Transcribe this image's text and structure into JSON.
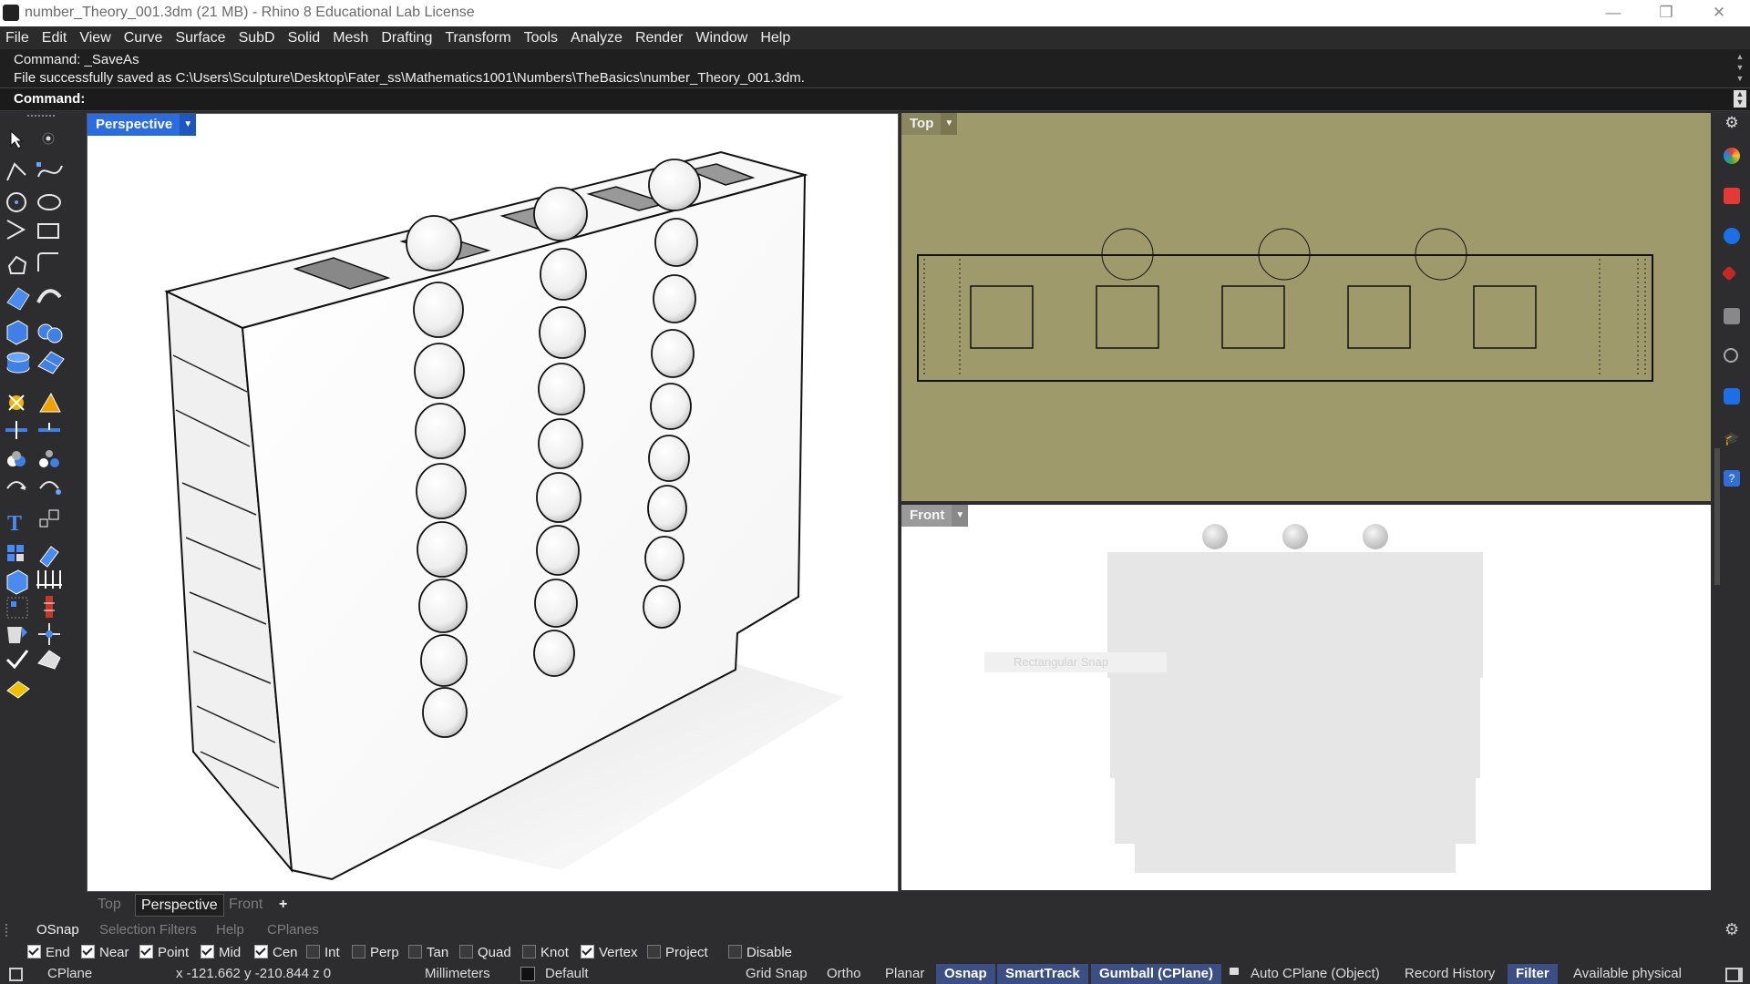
{
  "window": {
    "title": "number_Theory_001.3dm (21 MB) - Rhino 8 Educational Lab License",
    "controls": [
      "minimize-icon",
      "restore-icon",
      "close-icon"
    ]
  },
  "menu": [
    "File",
    "Edit",
    "View",
    "Curve",
    "Surface",
    "SubD",
    "Solid",
    "Mesh",
    "Drafting",
    "Transform",
    "Tools",
    "Analyze",
    "Render",
    "Window",
    "Help"
  ],
  "command": {
    "history_line1": "Command: _SaveAs",
    "history_line2": "File successfully saved as C:\\Users\\Sculpture\\Desktop\\Fater_ss\\Mathematics1001\\Numbers\\TheBasics\\number_Theory_001.3dm.",
    "prompt": "Command:"
  },
  "viewports": {
    "perspective": {
      "label": "Perspective"
    },
    "top": {
      "label": "Top"
    },
    "front": {
      "label": "Front",
      "ghost_hint": "Rectangular Snap"
    }
  },
  "viewport_tabs": [
    "Top",
    "Perspective",
    "Front",
    "+"
  ],
  "panel_tabs": [
    "OSnap",
    "Selection Filters",
    "Help",
    "CPlanes"
  ],
  "osnaps": [
    {
      "label": "End",
      "checked": true
    },
    {
      "label": "Near",
      "checked": true
    },
    {
      "label": "Point",
      "checked": true
    },
    {
      "label": "Mid",
      "checked": true
    },
    {
      "label": "Cen",
      "checked": true
    },
    {
      "label": "Int",
      "checked": false
    },
    {
      "label": "Perp",
      "checked": false
    },
    {
      "label": "Tan",
      "checked": false
    },
    {
      "label": "Quad",
      "checked": false
    },
    {
      "label": "Knot",
      "checked": false
    },
    {
      "label": "Vertex",
      "checked": true
    },
    {
      "label": "Project",
      "checked": false
    },
    {
      "label": "Disable",
      "checked": false
    }
  ],
  "status": {
    "cplane": "CPlane",
    "coords": "x -121.662  y -210.844  z 0",
    "units": "Millimeters",
    "layer": "Default",
    "grid_snap": "Grid Snap",
    "ortho": "Ortho",
    "planar": "Planar",
    "osnap": "Osnap",
    "smarttrack": "SmartTrack",
    "gumball": "Gumball (CPlane)",
    "auto_cplane": "Auto CPlane (Object)",
    "record_history": "Record History",
    "filter": "Filter",
    "memory": "Available physical"
  },
  "colors": {
    "active_viewport": "#2b6de0",
    "top_viewport_bg": "#9e9a6b",
    "enabled_pane": "#3c4f84"
  }
}
